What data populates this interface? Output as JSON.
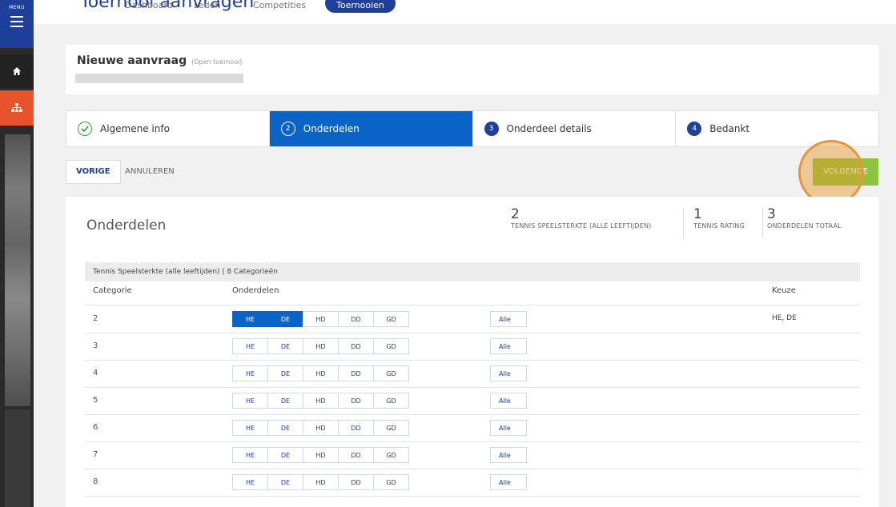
{
  "sidebar": {
    "menu_label": "MENU"
  },
  "topnav": {
    "title": "Toernooi aanvragen",
    "items": [
      "Dashboard",
      "Leden",
      "Competities"
    ],
    "active": "Toernooien"
  },
  "request": {
    "title": "Nieuwe aanvraag",
    "subtitle": "(Open toernooi)"
  },
  "steps": [
    {
      "num": "✓",
      "label": "Algemene info"
    },
    {
      "num": "2",
      "label": "Onderdelen"
    },
    {
      "num": "3",
      "label": "Onderdeel details"
    },
    {
      "num": "4",
      "label": "Bedankt"
    }
  ],
  "actions": {
    "prev": "VORIGE",
    "cancel": "ANNULEREN",
    "next": "VOLGENDE"
  },
  "panel": {
    "title": "Onderdelen",
    "stats": [
      {
        "value": "2",
        "label": "TENNIS SPEELSTERKTE (ALLE LEEFTIJDEN)"
      },
      {
        "value": "1",
        "label": "TENNIS RATING"
      },
      {
        "value": "3",
        "label": "ONDERDELEN TOTAAL"
      }
    ]
  },
  "table": {
    "group": "Tennis Speelsterkte (alle leeftijden)  |  8 Categorieën",
    "headers": {
      "categorie": "Categorie",
      "onderdelen": "Onderdelen",
      "keuze": "Keuze"
    },
    "options": [
      "HE",
      "DE",
      "HD",
      "DD",
      "GD"
    ],
    "all_label": "Alle",
    "rows": [
      {
        "cat": "2",
        "keuze": "HE, DE"
      },
      {
        "cat": "3",
        "keuze": ""
      },
      {
        "cat": "4",
        "keuze": ""
      },
      {
        "cat": "5",
        "keuze": ""
      },
      {
        "cat": "6",
        "keuze": ""
      },
      {
        "cat": "7",
        "keuze": ""
      },
      {
        "cat": "8",
        "keuze": ""
      }
    ]
  }
}
